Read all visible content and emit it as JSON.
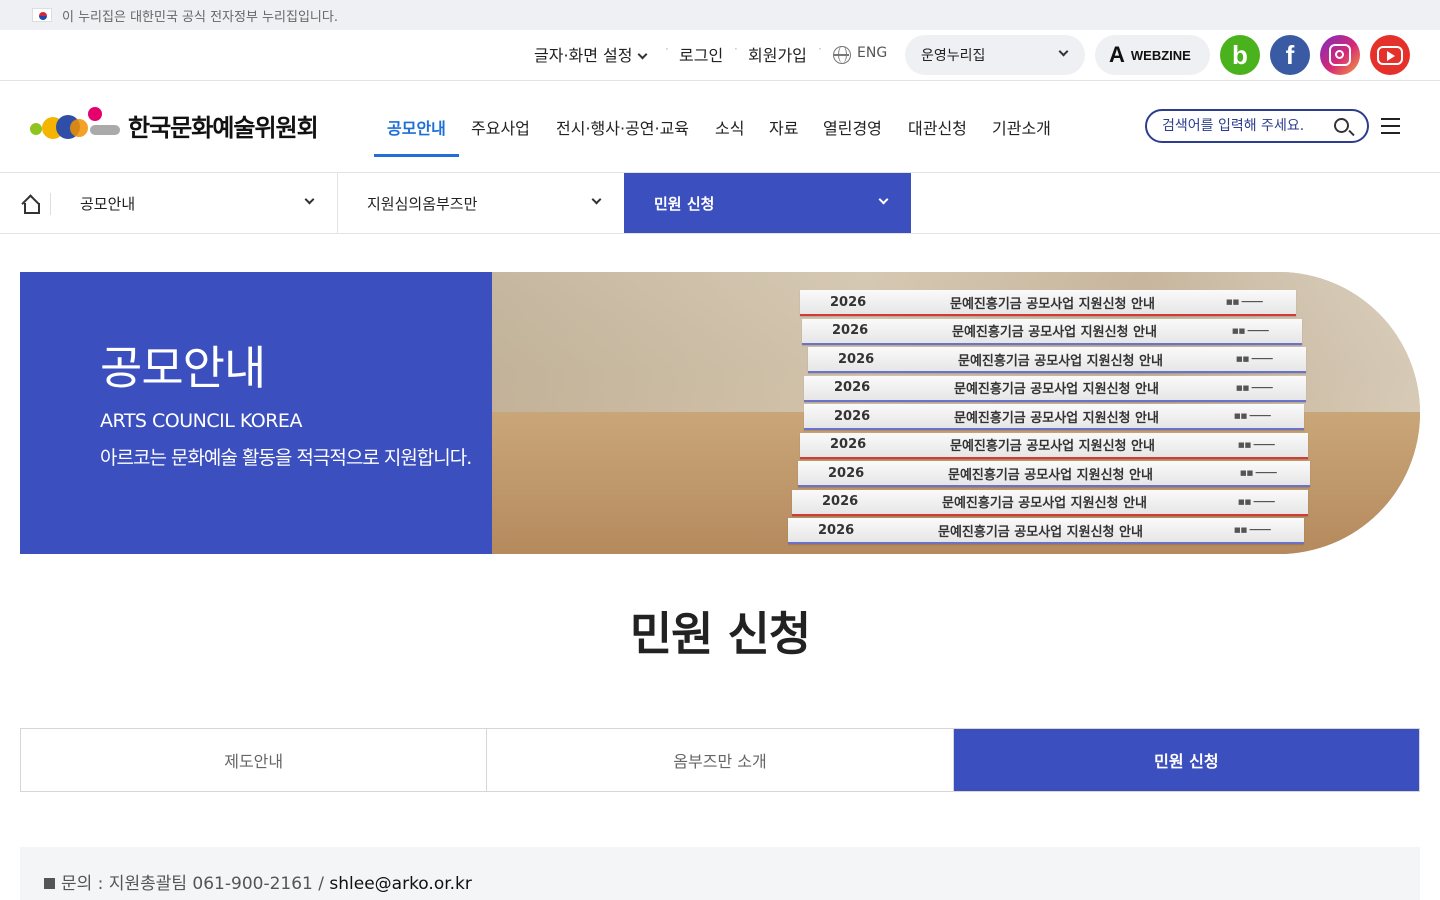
{
  "gov_banner": {
    "text": "이 누리집은 대한민국 공식 전자정부 누리집입니다."
  },
  "utility": {
    "font_screen": "글자·화면 설정",
    "login": "로그인",
    "signup": "회원가입",
    "lang": "ENG",
    "site_select": "운영누리집",
    "webzine": "WEBZINE",
    "social": [
      "blog-icon",
      "facebook-icon",
      "instagram-icon",
      "youtube-icon"
    ]
  },
  "header": {
    "logo_text": "한국문화예술위원회",
    "gnb": [
      "공모안내",
      "주요사업",
      "전시·행사·공연·교육",
      "소식",
      "자료",
      "열린경영",
      "대관신청",
      "기관소개"
    ],
    "active_gnb": "공모안내",
    "search_placeholder": "검색어를 입력해 주세요."
  },
  "location": {
    "depth1": "공모안내",
    "depth2": "지원심의옴부즈만",
    "depth3": "민원 신청"
  },
  "hero": {
    "title": "공모안내",
    "subtitle_en": "ARTS COUNCIL KOREA",
    "subtitle_ko": "아르코는 문화예술 활동을 적극적으로 지원합니다.",
    "book_year": "2026",
    "book_title": "문예진흥기금 공모사업 지원신청 안내"
  },
  "page_title": "민원 신청",
  "tabs": [
    "제도안내",
    "옴부즈만 소개",
    "민원 신청"
  ],
  "active_tab": "민원 신청",
  "info": {
    "label": "문의 : 지원총괄팀 061-900-2161 / ",
    "email": "shlee@arko.or.kr"
  },
  "colors": {
    "primary": "#3b4fbf",
    "gnb_active": "#1f6fd6"
  }
}
